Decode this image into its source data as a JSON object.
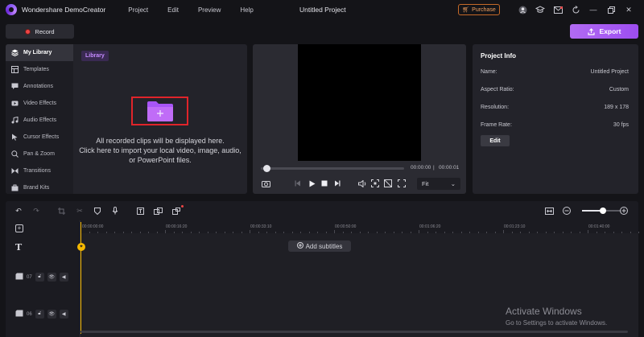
{
  "app": {
    "name": "Wondershare DemoCreator",
    "project_title": "Untitled Project",
    "menu": [
      "Project",
      "Edit",
      "Preview",
      "Help"
    ],
    "purchase_label": "Purchase"
  },
  "toolbar": {
    "record_label": "Record",
    "export_label": "Export"
  },
  "sidebar": {
    "items": [
      {
        "label": "My Library",
        "icon": "layers-icon",
        "active": true
      },
      {
        "label": "Templates",
        "icon": "templates-icon"
      },
      {
        "label": "Annotations",
        "icon": "annotation-icon"
      },
      {
        "label": "Video Effects",
        "icon": "video-effects-icon"
      },
      {
        "label": "Audio Effects",
        "icon": "audio-effects-icon"
      },
      {
        "label": "Cursor Effects",
        "icon": "cursor-icon"
      },
      {
        "label": "Pan & Zoom",
        "icon": "pan-zoom-icon"
      },
      {
        "label": "Transitions",
        "icon": "transitions-icon"
      },
      {
        "label": "Brand Kits",
        "icon": "brand-kit-icon"
      }
    ]
  },
  "library": {
    "tag": "Library",
    "empty_line1": "All recorded clips will be displayed here.",
    "empty_line2": "Click here to import your local video, image, audio,",
    "empty_line3": "or PowerPoint files."
  },
  "preview": {
    "current_time": "00:00:00",
    "total_time": "00:00:01",
    "fit_label": "Fit",
    "progress": 0.02
  },
  "project_info": {
    "title": "Project Info",
    "rows": [
      {
        "label": "Name:",
        "value": "Untitled Project"
      },
      {
        "label": "Aspect Ratio:",
        "value": "Custom"
      },
      {
        "label": "Resolution:",
        "value": "189 x 178"
      },
      {
        "label": "Frame Rate:",
        "value": "30 fps"
      }
    ],
    "edit_label": "Edit"
  },
  "timeline": {
    "ticks": [
      "00:00:00:00",
      "00:00:16:20",
      "00:00:33:10",
      "00:00:50:00",
      "00:01:06:20",
      "00:01:23:10",
      "00:01:40:00"
    ],
    "add_subtitles_label": "Add subtitles",
    "tracks": [
      {
        "number": "07"
      },
      {
        "number": "06"
      }
    ],
    "zoom_level": 0.55
  },
  "watermark": {
    "line1": "Activate Windows",
    "line2": "Go to Settings to activate Windows."
  },
  "colors": {
    "accent": "#a259f2",
    "record": "#ef4444",
    "playhead": "#f5b800",
    "highlight_box": "#e0242a"
  }
}
